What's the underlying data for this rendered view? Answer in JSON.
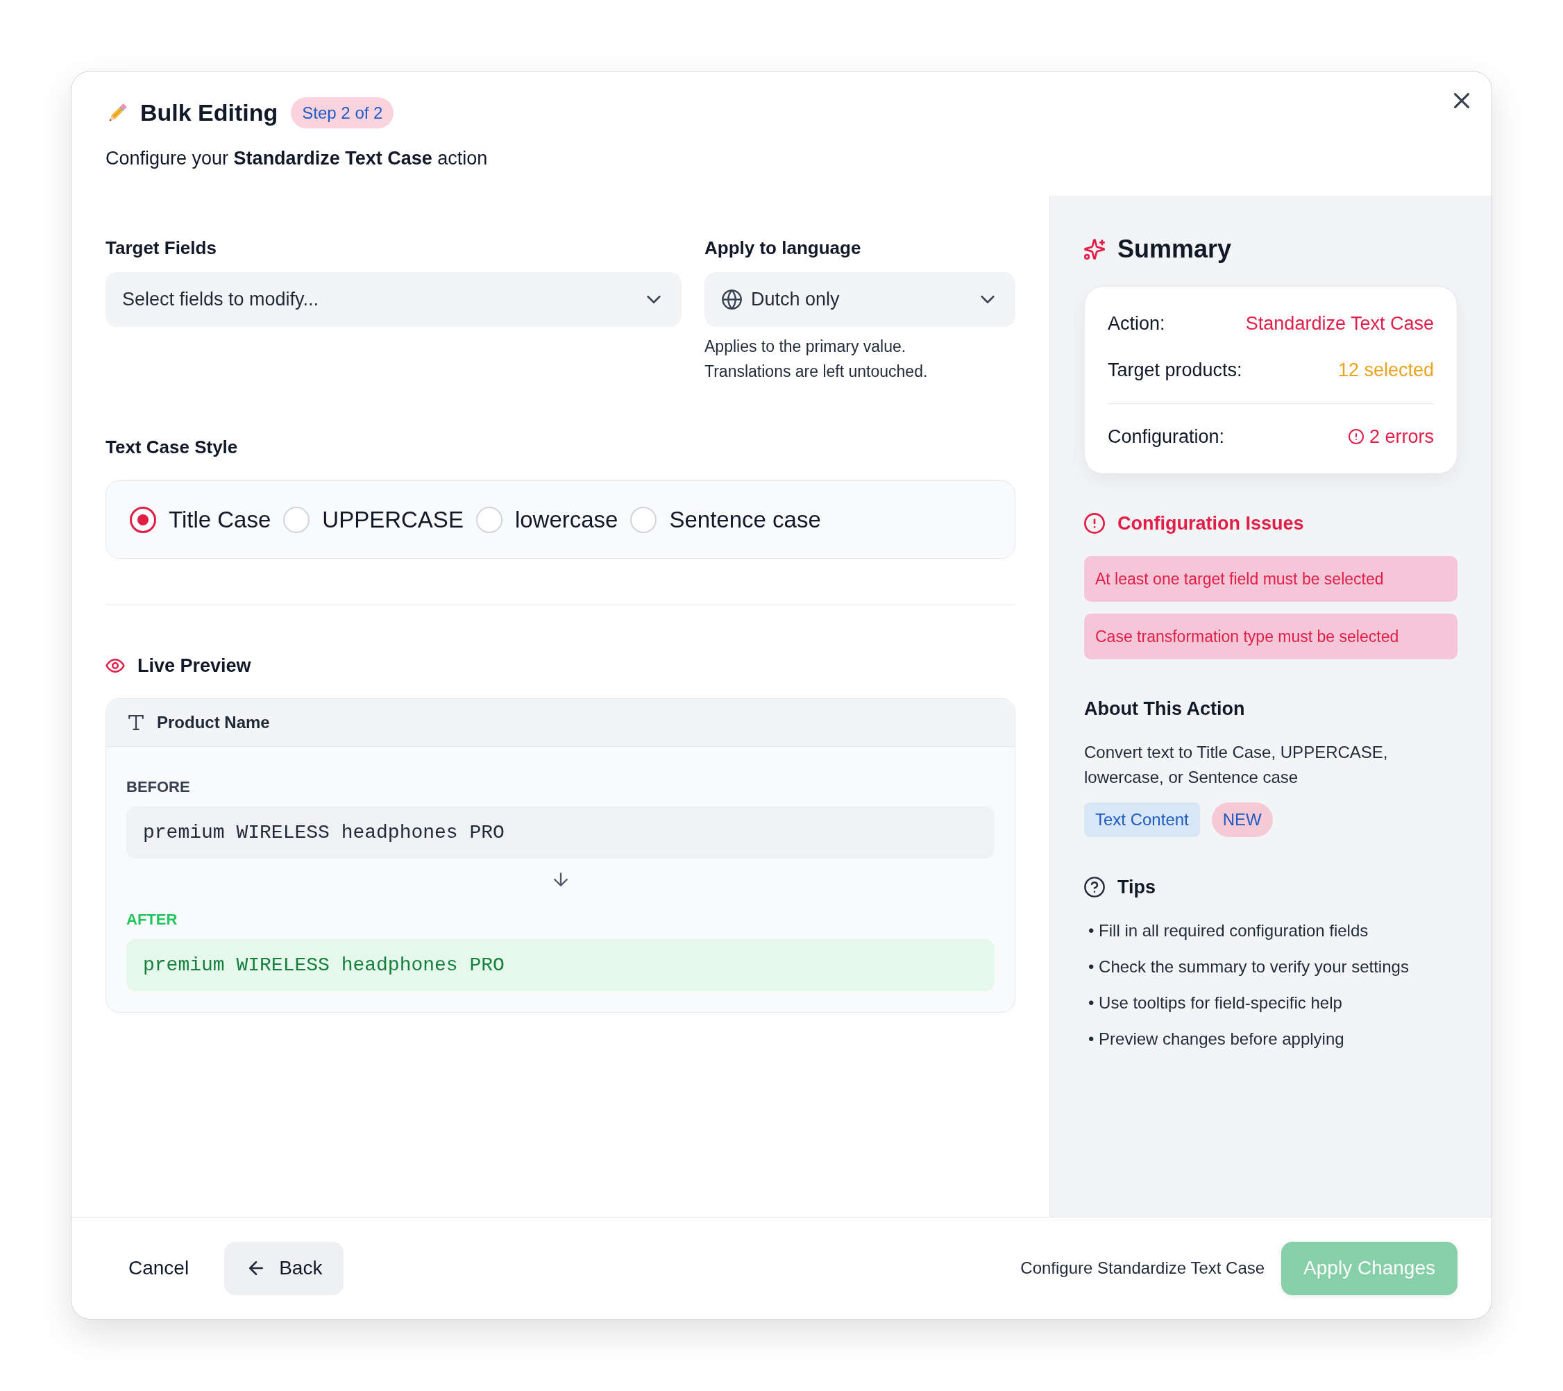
{
  "header": {
    "title": "Bulk Editing",
    "step_badge": "Step 2 of 2",
    "subtitle": "Configure your **Standardize Text Case** action"
  },
  "target_fields": {
    "label": "Target Fields",
    "placeholder": "Select fields to modify..."
  },
  "language": {
    "label": "Apply to language",
    "value": "Dutch only",
    "help": "Applies to the primary value. Translations are left untouched."
  },
  "text_case_style": {
    "label": "Text Case Style",
    "options": [
      {
        "label": "Title Case",
        "selected": true
      },
      {
        "label": "UPPERCASE",
        "selected": false
      },
      {
        "label": "lowercase",
        "selected": false
      },
      {
        "label": "Sentence case",
        "selected": false
      }
    ]
  },
  "live_preview": {
    "title": "Live Preview",
    "field": "Product Name",
    "before_label": "BEFORE",
    "before_value": "premium WIRELESS headphones PRO",
    "after_label": "AFTER",
    "after_value": "premium WIRELESS headphones PRO"
  },
  "summary": {
    "title": "Summary",
    "rows": [
      {
        "label": "Action:",
        "value": "Standardize Text Case",
        "color": "#e11d48"
      },
      {
        "label": "Target products:",
        "value": "12 selected",
        "color": "#eba31d"
      }
    ],
    "status": {
      "label": "Configuration:",
      "value": "2 errors"
    }
  },
  "issues": {
    "title": "Configuration Issues",
    "items": [
      "At least one target field must be selected",
      "Case transformation type must be selected"
    ]
  },
  "about": {
    "title": "About This Action",
    "description": "Convert text to Title Case, UPPERCASE, lowercase, or Sentence case",
    "tags": [
      {
        "label": "Text Content",
        "kind": "category"
      },
      {
        "label": "NEW",
        "kind": "new"
      }
    ]
  },
  "tips": {
    "title": "Tips",
    "items": [
      "• Fill in all required configuration fields",
      "• Check the summary to verify your settings",
      "• Use tooltips for field-specific help",
      "• Preview changes before applying"
    ]
  },
  "footer": {
    "cancel": "Cancel",
    "back": "Back",
    "status": "Configure Standardize Text Case",
    "apply": {
      "label": "Apply Changes",
      "disabled": true
    }
  }
}
